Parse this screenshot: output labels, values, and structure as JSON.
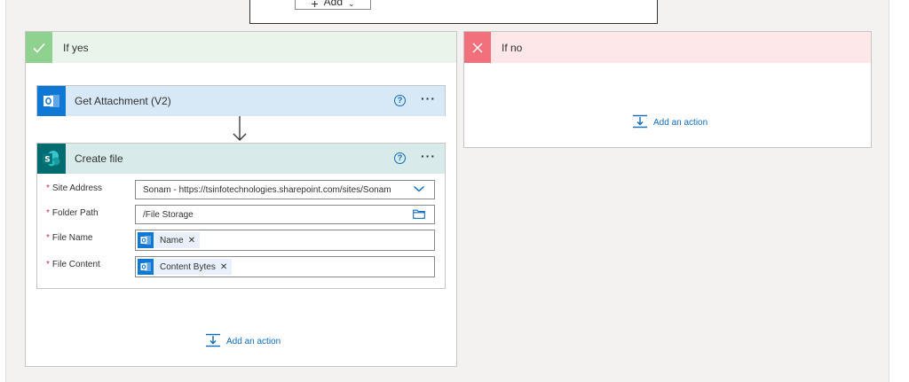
{
  "top": {
    "add_label": "Add"
  },
  "branches": {
    "yes": {
      "title": "If yes"
    },
    "no": {
      "title": "If no",
      "add_action_label": "Add an action"
    }
  },
  "actions": {
    "get_attachment": {
      "title": "Get Attachment (V2)"
    },
    "create_file": {
      "title": "Create file",
      "fields": {
        "site_address": {
          "label": "Site Address",
          "value": "Sonam - https://tsinfotechnologies.sharepoint.com/sites/Sonam"
        },
        "folder_path": {
          "label": "Folder Path",
          "value": "/File Storage"
        },
        "file_name": {
          "label": "File Name",
          "token": "Name"
        },
        "file_content": {
          "label": "File Content",
          "token": "Content Bytes"
        }
      }
    }
  },
  "yes_add_action_label": "Add an action",
  "colors": {
    "yes_header": "#e9f5ea",
    "yes_icon": "#8fd18f",
    "no_header": "#fde7e9",
    "no_icon": "#f1707b",
    "outlook": "#0f78d4",
    "sharepoint": "#036c70",
    "link": "#0f6cbd"
  },
  "icons": {
    "yes": "checkmark-icon",
    "no": "close-icon",
    "outlook": "outlook-icon",
    "sharepoint": "sharepoint-icon",
    "help": "help-circle-icon",
    "more": "more-options-icon",
    "dropdown": "chevron-down-icon",
    "folder": "folder-icon",
    "add_action": "add-action-icon"
  }
}
